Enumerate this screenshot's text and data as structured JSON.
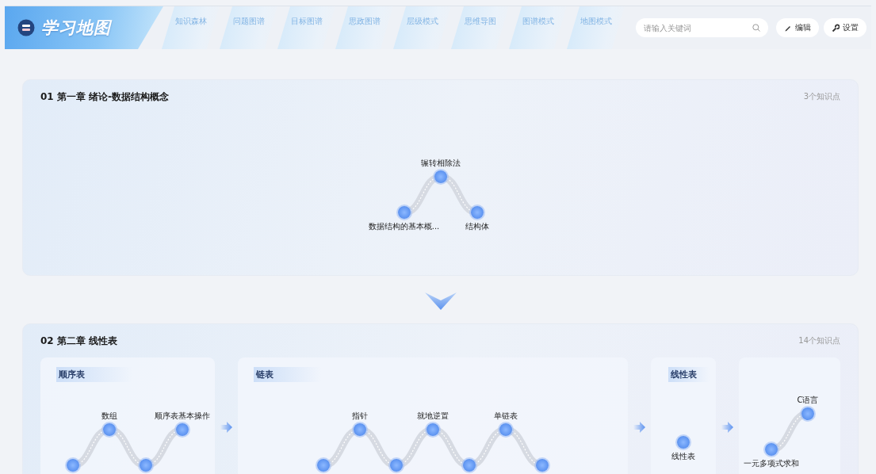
{
  "header": {
    "logo_text": "学习地图",
    "nav": [
      {
        "label": "知识森林",
        "selected": false
      },
      {
        "label": "问题图谱",
        "selected": false
      },
      {
        "label": "目标图谱",
        "selected": false
      },
      {
        "label": "思政图谱",
        "selected": false
      },
      {
        "label": "层级模式",
        "selected": false
      },
      {
        "label": "思维导图",
        "selected": false
      },
      {
        "label": "图谱模式",
        "selected": false
      },
      {
        "label": "地图模式",
        "selected": false
      }
    ],
    "search": {
      "placeholder": "请输入关键词"
    },
    "buttons": [
      {
        "label": "编辑",
        "kind": "edit"
      },
      {
        "label": "设置",
        "kind": "settings"
      }
    ]
  },
  "chapters": [
    {
      "title": "01 第一章 绪论-数据结构概念",
      "count": "3个知识点",
      "groups": [
        {
          "kind": "plain",
          "nodes": [
            {
              "kind": "valley",
              "label": "数据结构的基本概..."
            },
            {
              "kind": "peak",
              "label": "辗转相除法"
            },
            {
              "kind": "valley",
              "label": "结构体"
            }
          ]
        }
      ]
    },
    {
      "title": "02 第二章 线性表",
      "count": "14个知识点",
      "groups": [
        {
          "kind": "panel",
          "title": "顺序表",
          "nodes": [
            {
              "kind": "valley"
            },
            {
              "kind": "peak",
              "label": "数组"
            },
            {
              "kind": "valley"
            },
            {
              "kind": "peak",
              "label": "顺序表基本操作"
            }
          ]
        },
        {
          "kind": "panel",
          "title": "链表",
          "nodes": [
            {
              "kind": "valley"
            },
            {
              "kind": "peak",
              "label": "指针"
            },
            {
              "kind": "valley"
            },
            {
              "kind": "peak",
              "label": "就地逆置"
            },
            {
              "kind": "valley"
            },
            {
              "kind": "peak",
              "label": "单链表"
            },
            {
              "kind": "valley"
            }
          ]
        },
        {
          "kind": "panel",
          "title": "线性表",
          "nodes": [
            {
              "kind": "single",
              "label": "线性表"
            }
          ]
        },
        {
          "kind": "panel",
          "nodes": [
            {
              "kind": "valley",
              "label": "一元多项式求和"
            },
            {
              "kind": "peak",
              "label": "C语言"
            }
          ]
        }
      ]
    }
  ]
}
